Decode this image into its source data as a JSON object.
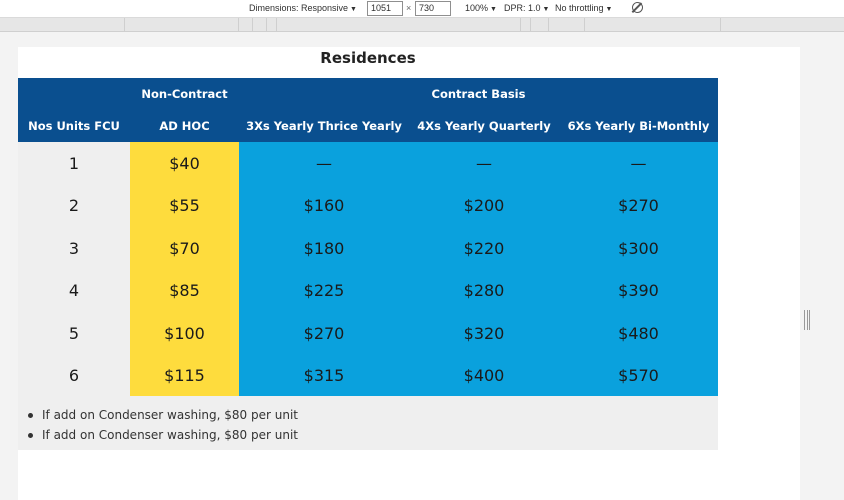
{
  "devtools": {
    "dimensions_label": "Dimensions: Responsive",
    "width_value": "1051",
    "times": "×",
    "height_value": "730",
    "zoom": "100%",
    "dpr": "DPR: 1.0",
    "throttling": "No throttling",
    "rotate_icon": "rotate-icon"
  },
  "page": {
    "title": "Residences"
  },
  "table": {
    "group_headers": {
      "non_contract": "Non-Contract",
      "contract_basis": "Contract Basis"
    },
    "columns": [
      "Nos Units FCU",
      "AD HOC",
      "3Xs Yearly Thrice Yearly",
      "4Xs Yearly Quarterly",
      "6Xs Yearly Bi-Monthly"
    ],
    "rows": [
      [
        "1",
        "$40",
        "—",
        "—",
        "—"
      ],
      [
        "2",
        "$55",
        "$160",
        "$200",
        "$270"
      ],
      [
        "3",
        "$70",
        "$180",
        "$220",
        "$300"
      ],
      [
        "4",
        "$85",
        "$225",
        "$280",
        "$390"
      ],
      [
        "5",
        "$100",
        "$270",
        "$320",
        "$480"
      ],
      [
        "6",
        "$115",
        "$315",
        "$400",
        "$570"
      ]
    ],
    "colors": {
      "header_bg": "#0a4f8f",
      "adhoc_bg": "#fedc3d",
      "contract_bg": "#0aa1dd",
      "units_bg": "#efefef"
    }
  },
  "notes": [
    "If add on Condenser washing, $80 per unit",
    "If add on Condenser washing, $80 per unit"
  ]
}
